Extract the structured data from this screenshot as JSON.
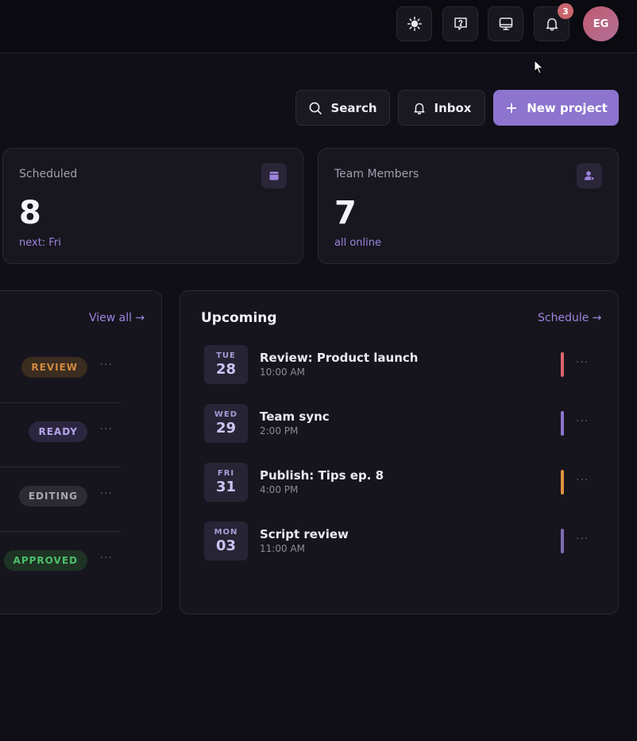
{
  "topbar": {
    "theme_icon": "sun-icon",
    "help_icon": "question-icon",
    "display_icon": "monitor-icon",
    "notification_icon": "bell-icon",
    "notification_count": "3",
    "avatar_initials": "EG"
  },
  "actions": {
    "search_label": "Search",
    "inbox_label": "Inbox",
    "new_project_label": "New project"
  },
  "stats": [
    {
      "label": "Scheduled",
      "value": "8",
      "sub": "next: Fri",
      "icon": "calendar-icon"
    },
    {
      "label": "Team Members",
      "value": "7",
      "sub": "all online",
      "icon": "user-icon"
    }
  ],
  "projects": {
    "view_all_label": "View all →",
    "rows": [
      {
        "status": "REVIEW"
      },
      {
        "status": "READY"
      },
      {
        "status": "EDITING"
      },
      {
        "status": "APPROVED"
      }
    ],
    "more": "···"
  },
  "upcoming": {
    "title": "Upcoming",
    "schedule_label": "Schedule →",
    "events": [
      {
        "dow": "TUE",
        "day": "28",
        "title": "Review: Product launch",
        "time": "10:00 AM",
        "color": "#d9666c"
      },
      {
        "dow": "WED",
        "day": "29",
        "title": "Team sync",
        "time": "2:00 PM",
        "color": "#8d74cf"
      },
      {
        "dow": "FRI",
        "day": "31",
        "title": "Publish: Tips ep. 8",
        "time": "4:00 PM",
        "color": "#e0913c"
      },
      {
        "dow": "MON",
        "day": "03",
        "title": "Script review",
        "time": "11:00 AM",
        "color": "#7f6db3"
      }
    ],
    "more": "···"
  }
}
